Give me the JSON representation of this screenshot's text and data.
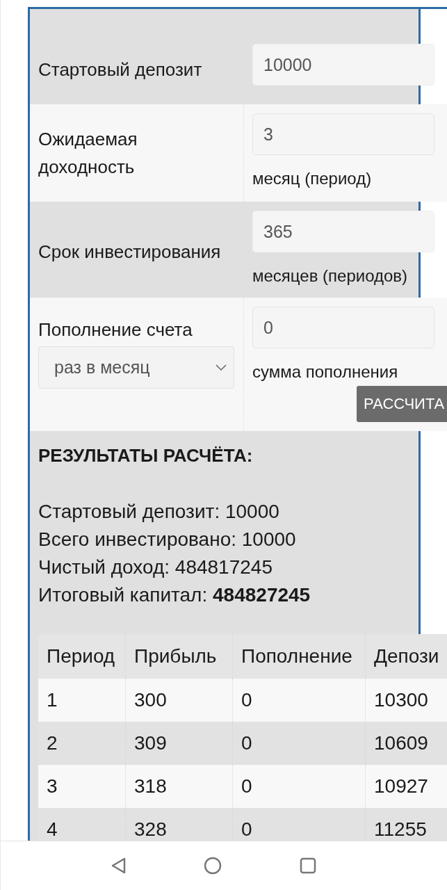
{
  "form": {
    "fields": [
      {
        "kind": "input",
        "label": "Стартовый депозит",
        "value": "10000"
      },
      {
        "kind": "input",
        "label": "Ожидаемая доходность",
        "value": "3",
        "note": "месяц (период)"
      },
      {
        "kind": "input",
        "label": "Срок инвестирования",
        "value": "365",
        "note": "месяцев (периодов)"
      },
      {
        "kind": "select",
        "label": "Пополнение счета",
        "select": "раз в месяц",
        "value": "0",
        "note": "сумма пополнения"
      }
    ],
    "button": "РАССЧИТА"
  },
  "results": {
    "title": "РЕЗУЛЬТАТЫ РАСЧЁТА:",
    "lines": [
      "Стартовый депозит: 10000",
      "Всего инвестировано: 10000",
      "Чистый доход: 484817245",
      "Итоговый капитал: **484827245**"
    ],
    "table": {
      "columns": [
        "Период",
        "Прибыль",
        "Пополнение",
        "Депози"
      ],
      "rows": [
        [
          "1",
          "300",
          "0",
          "10300"
        ],
        [
          "2",
          "309",
          "0",
          "10609"
        ],
        [
          "3",
          "318",
          "0",
          "10927"
        ],
        [
          "4",
          "328",
          "0",
          "11255"
        ]
      ]
    }
  }
}
